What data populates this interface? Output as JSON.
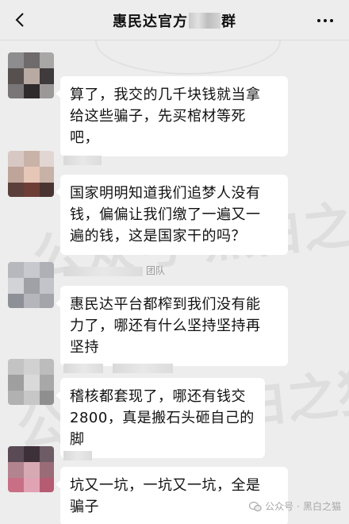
{
  "header": {
    "title_prefix": "惠民达官方",
    "title_suffix": "群"
  },
  "messages": [
    {
      "text": "算了，我交的几千块钱就当拿\n给这些骗子，先买棺材等死\n吧，",
      "name_suffix": ""
    },
    {
      "text": "国家明明知道我们追梦人没有\n钱，偏偏让我们缴了一遍又一\n遍的钱，这是国家干的吗？",
      "name_suffix": ""
    },
    {
      "text": "惠民达平台都榨到我们没有能\n力了，哪还有什么坚持坚持再\n坚持",
      "name_suffix": "团队"
    },
    {
      "text": "稽核都套现了，哪还有钱交\n2800，真是搬石头砸自己的\n脚",
      "name_suffix": ""
    },
    {
      "text": "坑又一坑，一坑又一坑，全是\n骗子",
      "name_suffix": ""
    }
  ],
  "watermark": {
    "text": "公众号·黑白之猫"
  },
  "footer": {
    "label": "公众号",
    "separator": "·",
    "account": "黑白之猫"
  },
  "icons": {
    "back": "chevron-left-icon",
    "more": "more-dots-icon",
    "avatar": "mosaic-avatar",
    "footer": "wechat-icon"
  },
  "colors": {
    "background": "#ededed",
    "bubble": "#ffffff",
    "text": "#111111",
    "meta": "#9a9a9a"
  }
}
